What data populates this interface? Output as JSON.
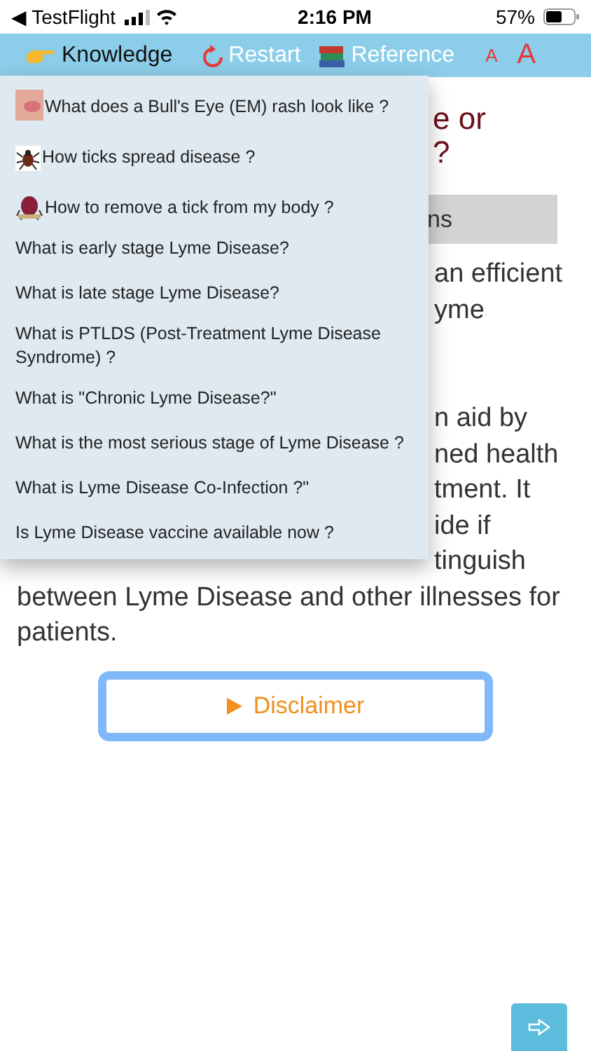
{
  "status_bar": {
    "back": "◀ TestFlight",
    "time": "2:16 PM",
    "battery": "57%"
  },
  "nav": {
    "items": [
      {
        "kind": "knowledge",
        "label": "Knowledge"
      },
      {
        "kind": "restart",
        "label": "Restart"
      },
      {
        "kind": "reference",
        "label": "Reference"
      }
    ],
    "font_small": "A",
    "font_large": "A"
  },
  "menu": {
    "items": [
      {
        "kind": "with_icon",
        "text": "What does a Bull's Eye (EM) rash look like ?"
      },
      {
        "kind": "with_icon",
        "text": "How ticks spread disease ?"
      },
      {
        "kind": "with_icon",
        "text": "How to remove a tick from my body ?"
      },
      {
        "kind": "plain",
        "text": "What is early stage Lyme Disease?"
      },
      {
        "kind": "plain",
        "text": "What is late stage Lyme Disease?"
      },
      {
        "kind": "plain",
        "text": "What is PTLDS (Post-Treatment Lyme Disease Syndrome) ?"
      },
      {
        "kind": "plain",
        "text": "What is \"Chronic Lyme Disease?\""
      },
      {
        "kind": "plain",
        "text": "What is the most serious stage of Lyme Disease ?"
      },
      {
        "kind": "plain",
        "text": "What is Lyme Disease Co-Infection ?\""
      },
      {
        "kind": "plain",
        "text": "Is Lyme Disease vaccine available now ?"
      }
    ]
  },
  "content": {
    "heading_lines": [
      "e or",
      "?"
    ],
    "box_text": "ns",
    "paragraphs": [
      [
        {
          "kind": "fragment",
          "text": "an efficient"
        },
        {
          "kind": "fragment",
          "text": "yme"
        }
      ],
      [
        {
          "kind": "fragment",
          "text": "n aid by"
        },
        {
          "kind": "fragment",
          "text": "ned health"
        },
        {
          "kind": "fragment",
          "text": "tment. It"
        },
        {
          "kind": "fragment",
          "text": "ide if"
        },
        {
          "kind": "fragment",
          "text": "tinguish"
        },
        {
          "kind": "full",
          "text": "between Lyme Disease and other illnesses for"
        },
        {
          "kind": "full",
          "text": "patients."
        }
      ]
    ]
  },
  "disclaimer": {
    "label": "Disclaimer"
  }
}
